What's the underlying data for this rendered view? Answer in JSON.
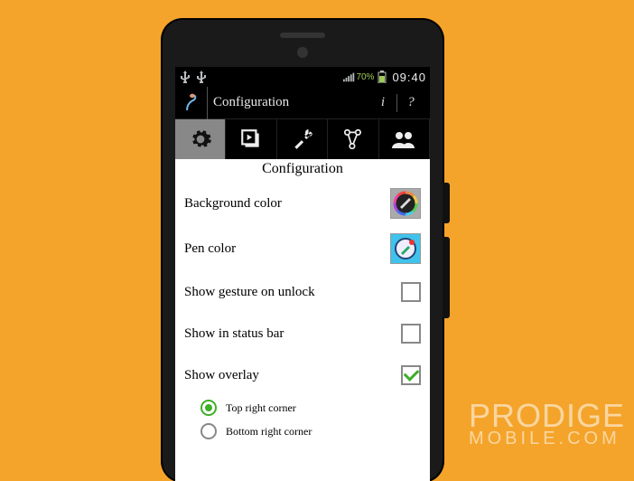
{
  "statusbar": {
    "battery_pct": "70%",
    "clock": "09:40"
  },
  "app": {
    "title": "Configuration",
    "action_info": "i",
    "action_help": "?"
  },
  "section_title": "Configuration",
  "items": {
    "background_color": "Background color",
    "pen_color": "Pen color",
    "show_gesture": "Show gesture on unlock",
    "show_statusbar": "Show in status bar",
    "show_overlay": "Show overlay"
  },
  "overlay_options": {
    "top_right": "Top right corner",
    "bottom_right": "Bottom right corner"
  },
  "checkbox_state": {
    "show_gesture": false,
    "show_statusbar": false,
    "show_overlay": true
  },
  "radio_selected": "top_right",
  "watermark": {
    "line1": "PRODIGE",
    "line2": "MOBILE.COM"
  }
}
